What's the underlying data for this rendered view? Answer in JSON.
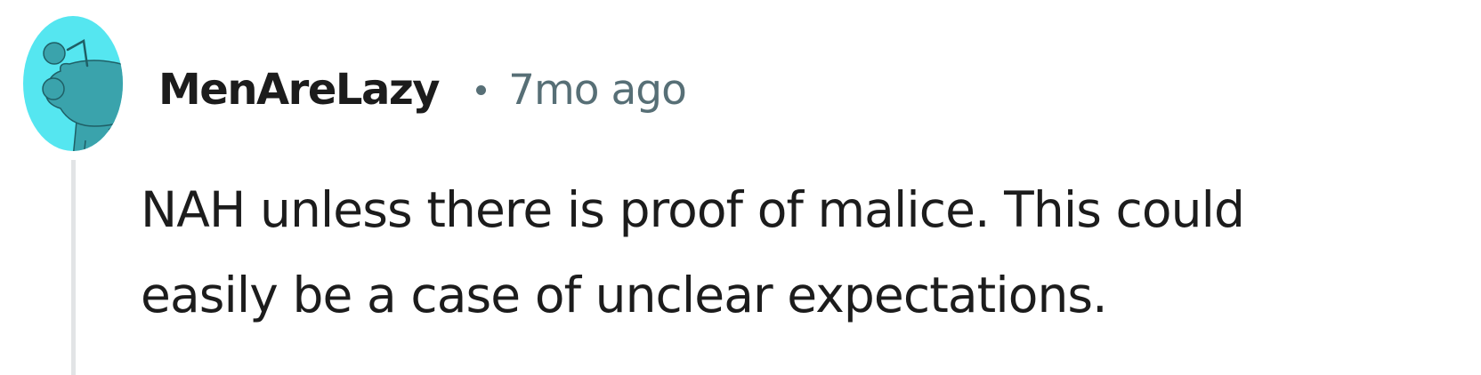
{
  "comment": {
    "author": "MenAreLazy",
    "separator": "•",
    "time_ago": "7mo ago",
    "body_line_1": "NAH unless there is proof of malice. This could",
    "body_line_2": "easily be a case of unclear expectations.",
    "avatar_icon": "snoo-avatar-icon"
  },
  "colors": {
    "avatar_bg": "#55e6f0",
    "avatar_figure": "#3aa3ac",
    "username": "#1c1c1c",
    "meta": "#576f76",
    "thread_line": "#e2e4e6",
    "text": "#1c1c1c"
  }
}
